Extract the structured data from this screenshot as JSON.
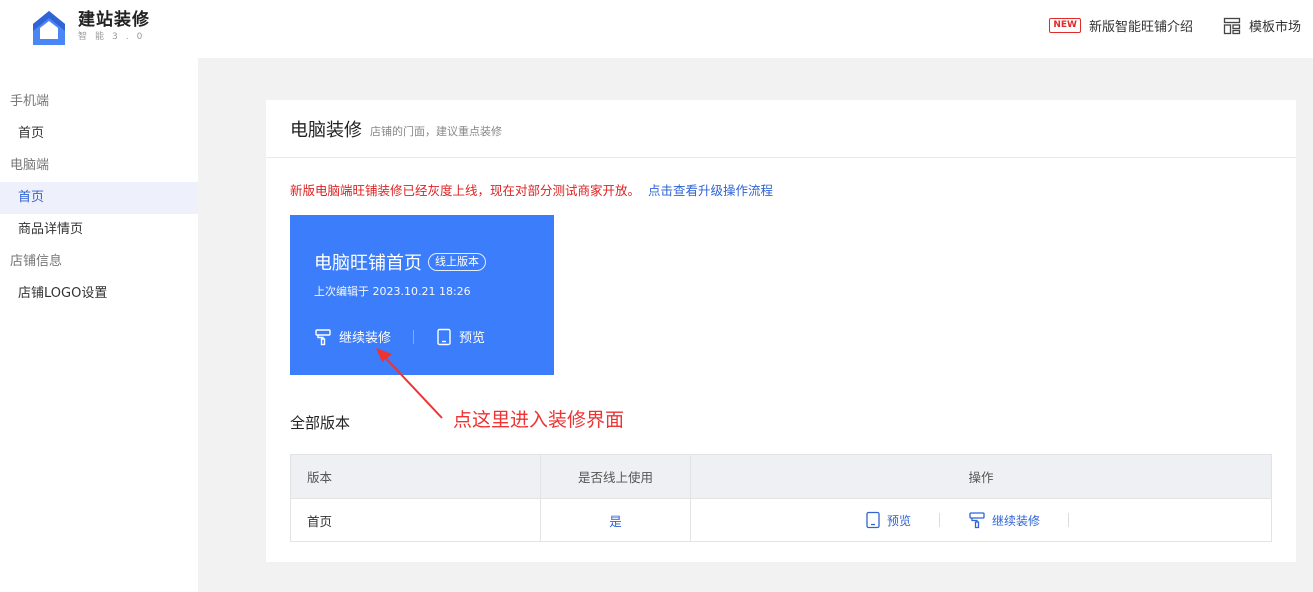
{
  "brand": {
    "title": "建站装修",
    "subtitle": "智能3.0"
  },
  "top_links": {
    "new_badge": "NEW",
    "intro": "新版智能旺铺介绍",
    "market": "模板市场"
  },
  "sidebar": {
    "groups": [
      {
        "label": "手机端",
        "items": [
          {
            "label": "首页"
          }
        ]
      },
      {
        "label": "电脑端",
        "items": [
          {
            "label": "首页",
            "active": true
          },
          {
            "label": "商品详情页"
          }
        ]
      },
      {
        "label": "店铺信息",
        "items": [
          {
            "label": "店铺LOGO设置"
          }
        ]
      }
    ]
  },
  "page": {
    "title": "电脑装修",
    "subtitle": "店铺的门面，建议重点装修",
    "notice": "新版电脑端旺铺装修已经灰度上线，现在对部分测试商家开放。",
    "notice_link": "点击查看升级操作流程"
  },
  "home_card": {
    "title": "电脑旺铺首页",
    "tag": "线上版本",
    "edited": "上次编辑于 2023.10.21 18:26",
    "continue_label": "继续装修",
    "preview_label": "预览"
  },
  "annotation": "点这里进入装修界面",
  "versions": {
    "title": "全部版本",
    "headers": [
      "版本",
      "是否线上使用",
      "操作"
    ],
    "rows": [
      {
        "name": "首页",
        "online": "是",
        "preview": "预览",
        "continue": "继续装修"
      }
    ]
  },
  "colors": {
    "accent": "#3b7dfa",
    "link": "#2f63d6",
    "warning": "#dd2222"
  }
}
